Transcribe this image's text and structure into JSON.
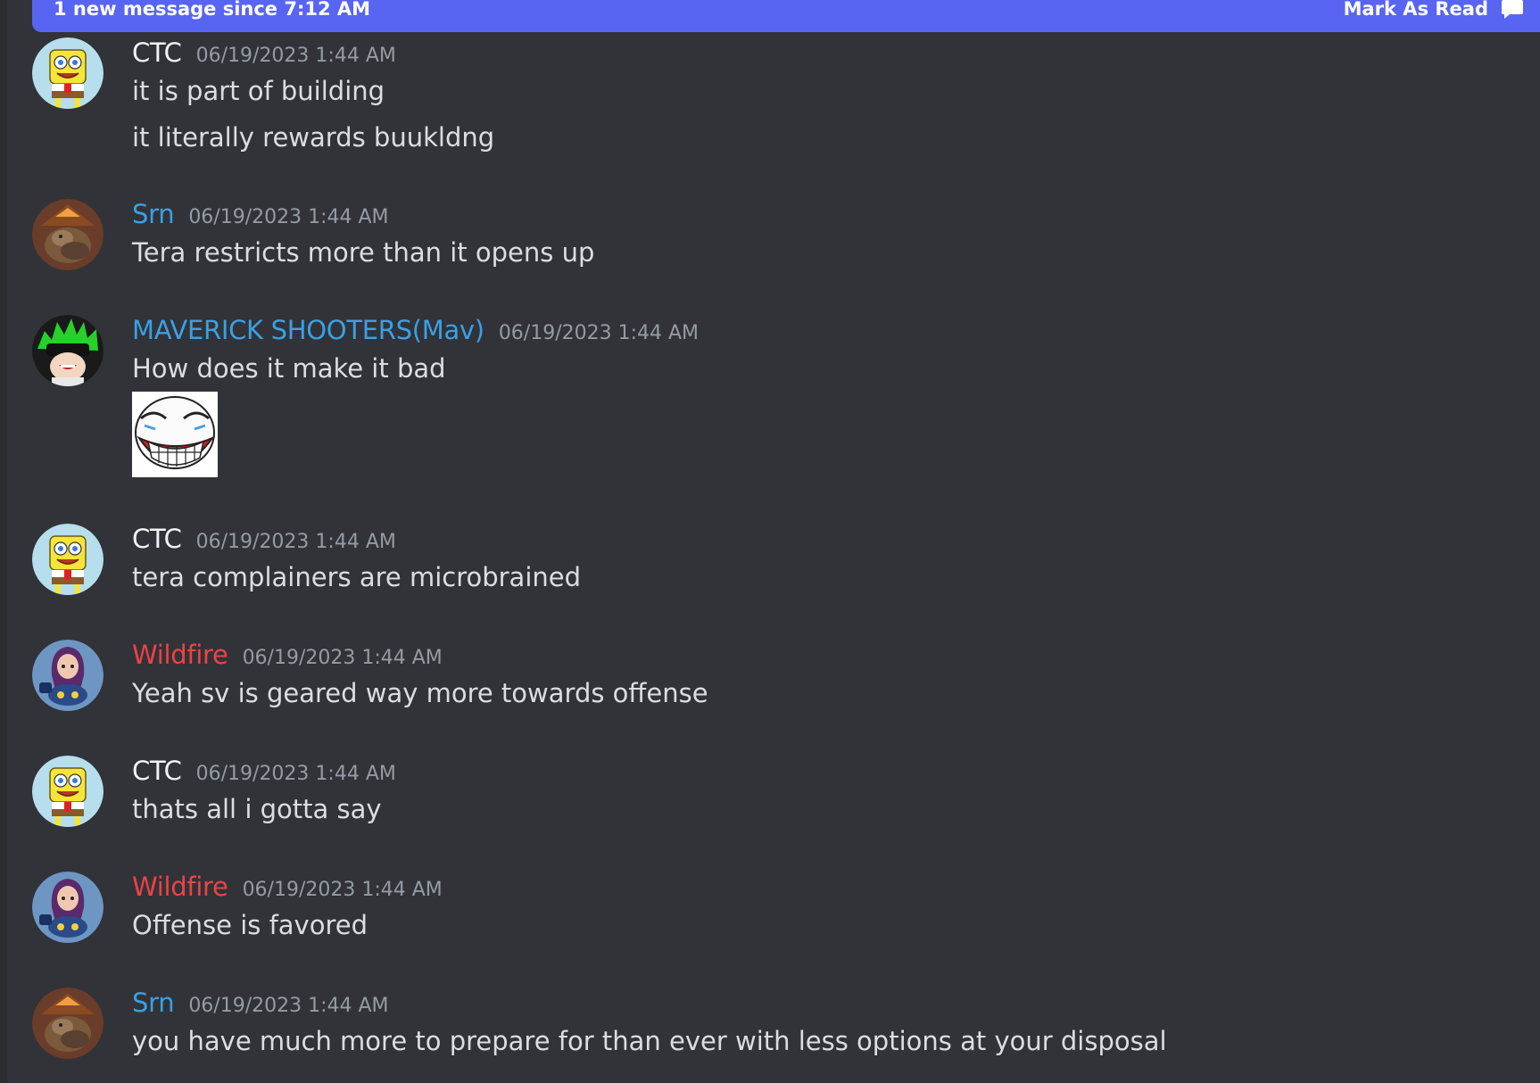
{
  "banner": {
    "text": "1 new message since 7:12 AM",
    "action_label": "Mark As Read"
  },
  "messages": [
    {
      "username": "CTC",
      "timestamp": "06/19/2023 1:44 AM",
      "lines": [
        "it is part of building",
        "it literally rewards buukldng"
      ],
      "avatar": "spongebob-avatar",
      "name_color": "#f2f3f5"
    },
    {
      "username": "Srn",
      "timestamp": "06/19/2023 1:44 AM",
      "lines": [
        "Tera restricts more than it opens up"
      ],
      "avatar": "cowboy-avatar",
      "name_color": "#3ba0e4"
    },
    {
      "username": "MAVERICK SHOOTERS(Mav)",
      "timestamp": "06/19/2023 1:44 AM",
      "lines": [
        "How does it make it bad"
      ],
      "avatar": "green-hair-avatar",
      "name_color": "#3ba0e4",
      "sticker": "laughing-face-sticker"
    },
    {
      "username": "CTC",
      "timestamp": "06/19/2023 1:44 AM",
      "lines": [
        "tera complainers are microbrained"
      ],
      "avatar": "spongebob-avatar",
      "name_color": "#f2f3f5"
    },
    {
      "username": "Wildfire",
      "timestamp": "06/19/2023 1:44 AM",
      "lines": [
        "Yeah sv is geared way more towards offense"
      ],
      "avatar": "anime-girl-avatar",
      "name_color": "#ed4245"
    },
    {
      "username": "CTC",
      "timestamp": "06/19/2023 1:44 AM",
      "lines": [
        "thats all i gotta say"
      ],
      "avatar": "spongebob-avatar",
      "name_color": "#f2f3f5"
    },
    {
      "username": "Wildfire",
      "timestamp": "06/19/2023 1:44 AM",
      "lines": [
        "Offense is favored"
      ],
      "avatar": "anime-girl-avatar",
      "name_color": "#ed4245"
    },
    {
      "username": "Srn",
      "timestamp": "06/19/2023 1:44 AM",
      "lines": [
        "you have much more to prepare for than ever with less options at your disposal"
      ],
      "avatar": "cowboy-avatar",
      "name_color": "#3ba0e4"
    }
  ]
}
